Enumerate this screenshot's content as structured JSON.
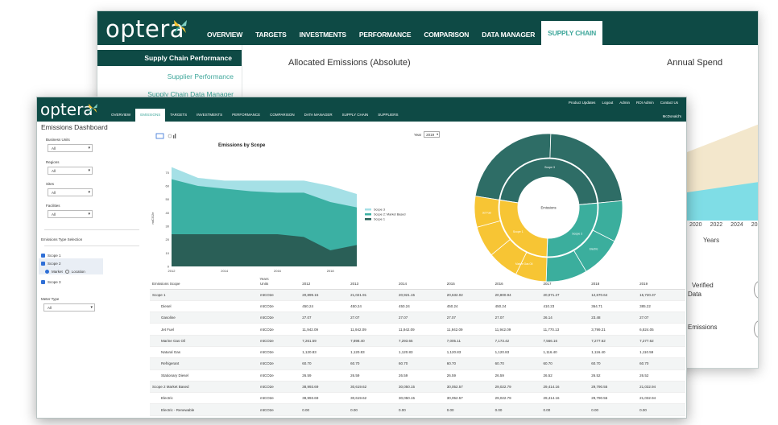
{
  "back": {
    "logo": "optera",
    "nav": [
      "OVERVIEW",
      "TARGETS",
      "INVESTMENTS",
      "PERFORMANCE",
      "COMPARISON",
      "DATA MANAGER",
      "SUPPLY CHAIN"
    ],
    "sidebar": [
      "Supply Chain Performance",
      "Supplier Performance",
      "Supply Chain Data Manager"
    ],
    "title_allocated": "Allocated Emissions (Absolute)",
    "title_spend": "Annual Spend",
    "years": [
      "2020",
      "2022",
      "2024",
      "2026"
    ],
    "years_label": "Years",
    "verified_1": "Verified",
    "verified_2": "Data",
    "emissions_text": "Emissions"
  },
  "front": {
    "logo": "optera",
    "nav": [
      "OVERVIEW",
      "EMISSIONS",
      "TARGETS",
      "INVESTMENTS",
      "PERFORMANCE",
      "COMPARISON",
      "DATA MANAGER",
      "SUPPLY CHAIN",
      "SUPPLIERS"
    ],
    "util": [
      "Product Updates",
      "Logout",
      "Admin",
      "ROI Admin",
      "Contact Us"
    ],
    "user": "McDonald's",
    "dashboard_title": "Emissions Dashboard",
    "filters": [
      {
        "label": "Business Units",
        "value": "All"
      },
      {
        "label": "Regions",
        "value": "All"
      },
      {
        "label": "Sites",
        "value": "All"
      },
      {
        "label": "Facilities",
        "value": "All"
      }
    ],
    "emissions_type_label": "Emissions Type Selection",
    "scope1": "Scope 1",
    "scope2": "Scope 2",
    "market": "Market",
    "location": "Location",
    "scope3": "Scope 3",
    "meter_type_label": "Meter Type",
    "meter_type_value": "All",
    "year_label": "Year",
    "year_value": "2019"
  },
  "chart_data": [
    {
      "type": "area",
      "title": "Emissions by Scope",
      "xlabel": "Years",
      "ylabel": "mtCO2e",
      "x": [
        2012,
        2013,
        2014,
        2015,
        2016,
        2017,
        2018,
        2019
      ],
      "x_ticks": [
        "2012",
        "2014",
        "2016",
        "2018"
      ],
      "y_ticks": [
        "0",
        "10",
        "20",
        "30",
        "40",
        "50",
        "60",
        "70"
      ],
      "ylim": [
        0,
        75
      ],
      "series": [
        {
          "name": "Scope 1",
          "values": [
            24,
            24,
            24,
            24,
            24,
            22,
            12,
            16
          ],
          "color": "#2a5f57"
        },
        {
          "name": "Scope 2: Market Based",
          "values": [
            65,
            60,
            58,
            56,
            55,
            55,
            48,
            44
          ],
          "color": "#3bb0a3"
        },
        {
          "name": "Scope 3",
          "values": [
            74,
            66,
            64,
            64,
            64,
            64,
            60,
            54
          ],
          "color": "#a5e0e6"
        }
      ],
      "legend": "right"
    },
    {
      "type": "pie",
      "center_label": "Emissions",
      "inner": [
        {
          "label": "Scope 1",
          "share": 0.27,
          "color": "#f7c534"
        },
        {
          "label": "Scope 2",
          "share": 0.27,
          "color": "#3bae9d"
        },
        {
          "label": "Scope 3",
          "share": 0.46,
          "color": "#2e6d66"
        }
      ],
      "outer_labels": [
        "Marine Gas Oil",
        "Jet Fuel",
        "Electric"
      ]
    }
  ],
  "table": {
    "columns": [
      "Emissions Scope",
      "Units",
      "2012",
      "2013",
      "2014",
      "2015",
      "2016",
      "2017",
      "2018",
      "2019"
    ],
    "rows": [
      {
        "name": "Scope 1",
        "sub": false,
        "cells": [
          "mtCO2e",
          "20,899.15",
          "21,021.91",
          "20,921.15",
          "20,632.02",
          "20,800.94",
          "20,071.27",
          "12,670.64",
          "15,720.37"
        ]
      },
      {
        "name": "Diesel",
        "sub": true,
        "cells": [
          "mtCO2e",
          "450.24",
          "450.24",
          "450.24",
          "450.24",
          "450.24",
          "410.23",
          "364.71",
          "385.22"
        ]
      },
      {
        "name": "Gasoline",
        "sub": true,
        "cells": [
          "mtCO2e",
          "27.07",
          "27.07",
          "27.07",
          "27.07",
          "27.07",
          "26.14",
          "23.48",
          "27.07"
        ]
      },
      {
        "name": "Jet Fuel",
        "sub": true,
        "cells": [
          "mtCO2e",
          "11,942.09",
          "11,942.09",
          "11,942.09",
          "11,942.09",
          "11,942.09",
          "11,770.13",
          "3,799.21",
          "6,824.05"
        ]
      },
      {
        "name": "Marine Gas Oil",
        "sub": true,
        "cells": [
          "mtCO2e",
          "7,261.59",
          "7,898.40",
          "7,293.65",
          "7,005.11",
          "7,173.42",
          "7,566.16",
          "7,277.62",
          "7,277.62"
        ]
      },
      {
        "name": "Natural Gas",
        "sub": true,
        "cells": [
          "mtCO2e",
          "1,120.83",
          "1,120.83",
          "1,120.83",
          "1,120.83",
          "1,120.83",
          "1,116.40",
          "1,116.40",
          "1,110.59"
        ]
      },
      {
        "name": "Refrigerant",
        "sub": true,
        "cells": [
          "mtCO2e",
          "60.70",
          "60.70",
          "60.70",
          "60.70",
          "60.70",
          "60.70",
          "60.70",
          "60.70"
        ]
      },
      {
        "name": "Stationary Diesel",
        "sub": true,
        "cells": [
          "mtCO2e",
          "26.59",
          "26.59",
          "26.59",
          "26.59",
          "26.59",
          "26.52",
          "26.52",
          "26.52"
        ]
      },
      {
        "name": "Scope 2 Market Based",
        "sub": false,
        "cells": [
          "mtCO2e",
          "38,993.69",
          "30,619.62",
          "30,050.15",
          "30,052.57",
          "29,022.79",
          "29,414.16",
          "29,790.55",
          "21,032.94"
        ]
      },
      {
        "name": "Electric",
        "sub": true,
        "cells": [
          "mtCO2e",
          "38,993.69",
          "30,619.62",
          "30,050.15",
          "30,052.57",
          "29,022.79",
          "29,414.16",
          "29,790.55",
          "21,032.94"
        ]
      },
      {
        "name": "Electric - Renewable",
        "sub": true,
        "cells": [
          "mtCO2e",
          "0.00",
          "0.00",
          "0.00",
          "0.00",
          "0.00",
          "0.00",
          "0.00",
          "0.00"
        ]
      }
    ]
  }
}
